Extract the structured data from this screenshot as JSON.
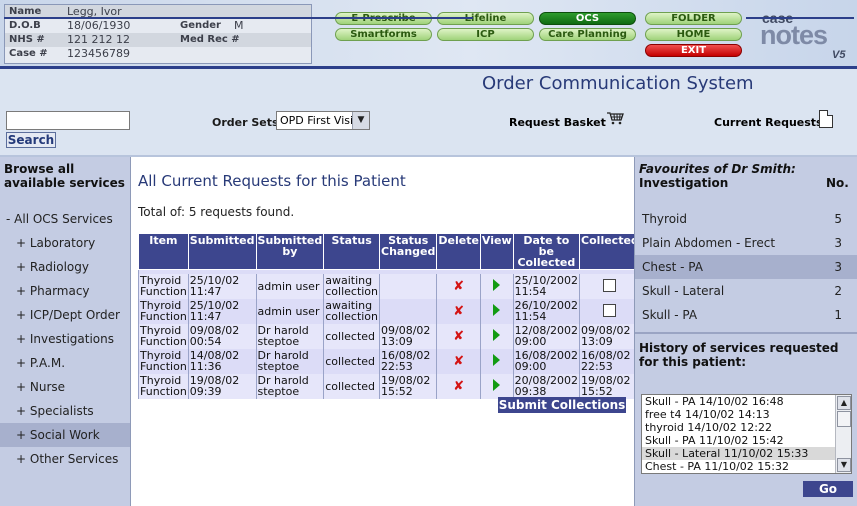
{
  "patient": {
    "name_label": "Name",
    "name": "Legg, Ivor",
    "dob_label": "D.O.B",
    "dob": "18/06/1930",
    "gender_label": "Gender",
    "gender": "M",
    "nhs_label": "NHS #",
    "nhs": "121 212 12",
    "medrec_label": "Med Rec #",
    "medrec": "",
    "case_label": "Case #",
    "case": "123456789"
  },
  "nav": {
    "e_prescribe": "E-Prescribe",
    "lifeline": "Lifeline",
    "ocs": "OCS",
    "folder": "FOLDER",
    "smartforms": "Smartforms",
    "icp": "ICP",
    "care_planning": "Care Planning",
    "home": "HOME",
    "exit": "EXIT",
    "active": "OCS"
  },
  "logo": {
    "line1": "case",
    "line2": "notes",
    "version": "V5"
  },
  "page_title": "Order Communication System",
  "toolbar": {
    "search_value": "",
    "search_button": "Search",
    "order_sets_label": "Order Sets",
    "order_sets_selected": "OPD First Visit",
    "request_basket_label": "Request Basket",
    "current_requests_label": "Current Requests"
  },
  "sidebar": {
    "title": "Browse all available services",
    "items": [
      {
        "label": "- All OCS Services"
      },
      {
        "label": "+ Laboratory"
      },
      {
        "label": "+ Radiology"
      },
      {
        "label": "+ Pharmacy"
      },
      {
        "label": "+ ICP/Dept Order"
      },
      {
        "label": "+ Investigations"
      },
      {
        "label": "+ P.A.M."
      },
      {
        "label": "+ Nurse"
      },
      {
        "label": "+ Specialists"
      },
      {
        "label": "+ Social Work",
        "selected": true
      },
      {
        "label": "+ Other Services"
      }
    ]
  },
  "main": {
    "title": "All Current Requests for this Patient",
    "total": "Total of: 5 requests found.",
    "columns": [
      "Item",
      "Submitted",
      "Submitted by",
      "Status",
      "Status Changed",
      "Delete",
      "View",
      "Date to be Collected",
      "Collected"
    ],
    "rows": [
      {
        "item": "Thyroid Function",
        "submitted": "25/10/02 11:47",
        "by": "admin user",
        "status": "awaiting collection",
        "changed": "",
        "collect_date": "25/10/2002 11:54",
        "collected": "checkbox"
      },
      {
        "item": "Thyroid Function",
        "submitted": "25/10/02 11:47",
        "by": "admin user",
        "status": "awaiting collection",
        "changed": "",
        "collect_date": "26/10/2002 11:54",
        "collected": "checkbox"
      },
      {
        "item": "Thyroid Function",
        "submitted": "09/08/02 00:54",
        "by": "Dr harold steptoe",
        "status": "collected",
        "changed": "09/08/02 13:09",
        "collect_date": "12/08/2002 09:00",
        "collected": "09/08/02 13:09"
      },
      {
        "item": "Thyroid Function",
        "submitted": "14/08/02 11:36",
        "by": "Dr harold steptoe",
        "status": "collected",
        "changed": "16/08/02 22:53",
        "collect_date": "16/08/2002 09:00",
        "collected": "16/08/02 22:53"
      },
      {
        "item": "Thyroid Function",
        "submitted": "19/08/02 09:39",
        "by": "Dr harold steptoe",
        "status": "collected",
        "changed": "19/08/02 15:52",
        "collect_date": "20/08/2002 09:38",
        "collected": "19/08/02 15:52"
      }
    ],
    "submit_button": "Submit Collections"
  },
  "favourites": {
    "title": "Favourites of Dr Smith:",
    "subtitle": "Investigation",
    "count_header": "No.",
    "items": [
      {
        "name": "Thyroid",
        "count": "5"
      },
      {
        "name": "Plain Abdomen - Erect",
        "count": "3"
      },
      {
        "name": "Chest - PA",
        "count": "3",
        "selected": true
      },
      {
        "name": "Skull - Lateral",
        "count": "2"
      },
      {
        "name": "Skull - PA",
        "count": "1"
      }
    ]
  },
  "history": {
    "title": "History of services requested for this patient:",
    "items": [
      {
        "text": "Skull - PA 14/10/02 16:48"
      },
      {
        "text": "free t4 14/10/02 14:13"
      },
      {
        "text": "thyroid 14/10/02 12:22"
      },
      {
        "text": "Skull - PA 11/10/02 15:42"
      },
      {
        "text": "Skull - Lateral 11/10/02 15:33",
        "selected": true
      },
      {
        "text": "Chest - PA 11/10/02 15:32"
      }
    ],
    "go_button": "Go"
  }
}
